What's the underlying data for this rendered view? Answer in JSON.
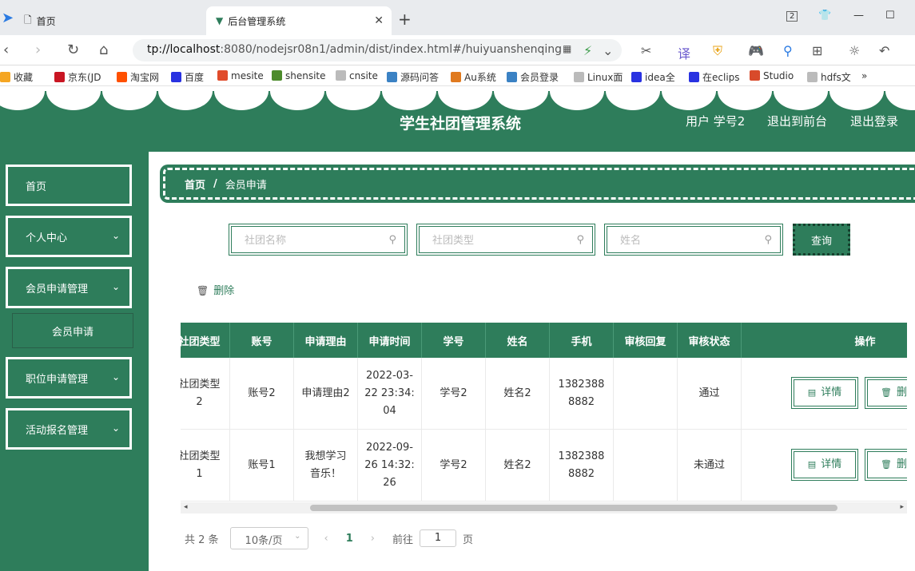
{
  "browser": {
    "tabs": [
      {
        "label": "首页"
      },
      {
        "label": "后台管理系统"
      }
    ],
    "url_prefix": "tp://localhost",
    "url_rest": ":8080/nodejsr08n1/admin/dist/index.html#/huiyuanshenqing",
    "bookmarks": [
      {
        "label": "收藏",
        "color": "#f5a623"
      },
      {
        "label": "京东(JD",
        "color": "#c91623"
      },
      {
        "label": "淘宝网",
        "color": "#ff5000"
      },
      {
        "label": "百度",
        "color": "#2932e1"
      },
      {
        "label": "mesite",
        "color": "#e04b2b"
      },
      {
        "label": "shensite",
        "color": "#4c8b2b"
      },
      {
        "label": "cnsite",
        "color": "#999999"
      },
      {
        "label": "源码问答",
        "color": "#3b82c4"
      },
      {
        "label": "Au系统",
        "color": "#e07a1f"
      },
      {
        "label": "会员登录",
        "color": "#3b82c4"
      },
      {
        "label": "Linux面",
        "color": "#999999"
      },
      {
        "label": "idea全",
        "color": "#2932e1"
      },
      {
        "label": "在eclips",
        "color": "#2932e1"
      },
      {
        "label": "Studio",
        "color": "#d84a2b"
      },
      {
        "label": "hdfs文",
        "color": "#999999"
      },
      {
        "label": "»",
        "color": "#ffffff"
      }
    ]
  },
  "header": {
    "title": "学生社团管理系统",
    "user_label": "用户 学号2",
    "back_label": "退出到前台",
    "logout_label": "退出登录"
  },
  "sidebar": {
    "items": [
      {
        "label": "首页"
      },
      {
        "label": "个人中心"
      },
      {
        "label": "会员申请管理"
      },
      {
        "label": "职位申请管理"
      },
      {
        "label": "活动报名管理"
      }
    ],
    "sub_item": "会员申请"
  },
  "breadcrumb": {
    "home": "首页",
    "sep": "/",
    "current": "会员申请"
  },
  "search": {
    "club_name_placeholder": "社团名称",
    "club_type_placeholder": "社团类型",
    "name_placeholder": "姓名",
    "query_label": "查询"
  },
  "actions": {
    "delete_label": "删除"
  },
  "table": {
    "headers": [
      "社团类型",
      "账号",
      "申请理由",
      "申请时间",
      "学号",
      "姓名",
      "手机",
      "审核回复",
      "审核状态",
      "操作"
    ],
    "rows": [
      {
        "club_type": "社团类型2",
        "account": "账号2",
        "reason": "申请理由2",
        "time": "2022-03-22 23:34:04",
        "student_no": "学号2",
        "name": "姓名2",
        "phone": "13823888882",
        "reply": "",
        "status": "通过"
      },
      {
        "club_type": "社团类型1",
        "account": "账号1",
        "reason": "我想学习音乐！",
        "time": "2022-09-26 14:32:26",
        "student_no": "学号2",
        "name": "姓名2",
        "phone": "13823888882",
        "reply": "",
        "status": "未通过"
      }
    ],
    "detail_label": "详情",
    "delete_label": "删"
  },
  "pagination": {
    "total": "共 2 条",
    "page_size": "10条/页",
    "current": "1",
    "goto_label": "前往",
    "goto_value": "1",
    "page_unit": "页"
  },
  "colors": {
    "primary": "#2e7d5b"
  }
}
